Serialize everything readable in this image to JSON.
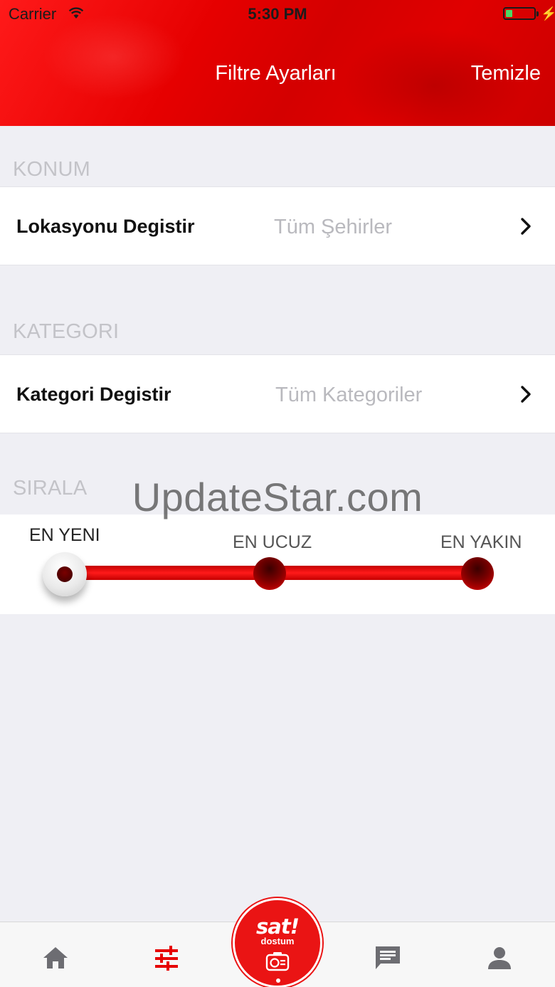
{
  "status_bar": {
    "carrier": "Carrier",
    "time": "5:30 PM",
    "battery_level": 0.2
  },
  "header": {
    "title": "Filtre Ayarları",
    "clear_label": "Temizle"
  },
  "sections": {
    "location": {
      "header": "KONUM",
      "label": "Lokasyonu Degistir",
      "value": "Tüm Şehirler"
    },
    "category": {
      "header": "KATEGORI",
      "label": "Kategori Degistir",
      "value": "Tüm Kategoriler"
    },
    "sort": {
      "header": "SIRALA",
      "options": [
        "EN YENI",
        "EN UCUZ",
        "EN YAKIN"
      ],
      "selected_index": 0
    }
  },
  "watermark": "UpdateStar.com",
  "tab_bar": {
    "items": [
      "home-icon",
      "filter-icon",
      "sell-button",
      "messages-icon",
      "profile-icon"
    ],
    "active": "filter-icon",
    "center_brand": "sat!",
    "center_sub": "dostum"
  },
  "colors": {
    "brand_red": "#e60000",
    "tab_inactive": "#6d6d72",
    "background": "#efeff4"
  }
}
